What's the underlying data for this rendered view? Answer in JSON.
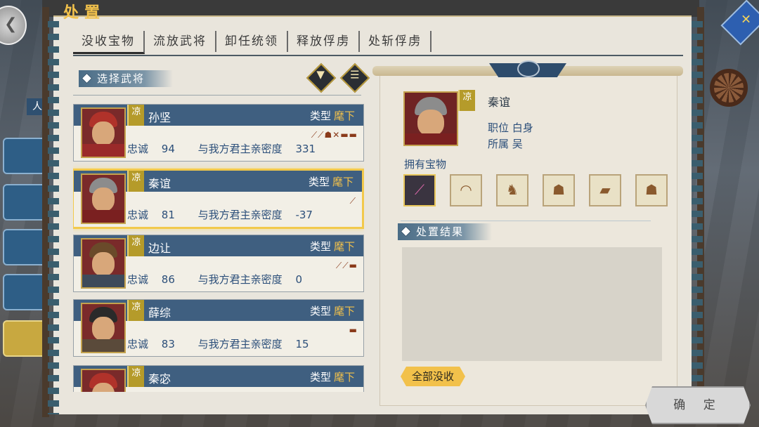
{
  "title": "处置",
  "tabs": [
    {
      "label": "没收宝物"
    },
    {
      "label": "流放武将"
    },
    {
      "label": "卸任统领"
    },
    {
      "label": "释放俘虏"
    },
    {
      "label": "处斩俘虏"
    }
  ],
  "side_label": "人",
  "left": {
    "section_label": "选择武将",
    "filter_icon": "filter-icon",
    "list_icon": "list-icon",
    "type_label": "类型",
    "generals": [
      {
        "faction": "凉",
        "name": "孙坚",
        "type": "麾下",
        "loyalty_label": "忠诚",
        "loyalty": "94",
        "intimacy_label": "与我方君主亲密度",
        "intimacy": "331",
        "items": "⟋⟋☗✕▬▬"
      },
      {
        "faction": "凉",
        "name": "秦谊",
        "type": "麾下",
        "loyalty_label": "忠诚",
        "loyalty": "81",
        "intimacy_label": "与我方君主亲密度",
        "intimacy": "-37",
        "items": "⟋"
      },
      {
        "faction": "凉",
        "name": "边让",
        "type": "麾下",
        "loyalty_label": "忠诚",
        "loyalty": "86",
        "intimacy_label": "与我方君主亲密度",
        "intimacy": "0",
        "items": "⟋⟋▬"
      },
      {
        "faction": "凉",
        "name": "薛综",
        "type": "麾下",
        "loyalty_label": "忠诚",
        "loyalty": "83",
        "intimacy_label": "与我方君主亲密度",
        "intimacy": "15",
        "items": "▬"
      },
      {
        "faction": "凉",
        "name": "秦宓",
        "type": "麾下"
      }
    ]
  },
  "right": {
    "faction": "凉",
    "name": "秦谊",
    "position_label": "职位",
    "position": "白身",
    "affiliation_label": "所属",
    "affiliation": "吴",
    "owned_label": "拥有宝物",
    "treasures": [
      "⟋",
      "◠",
      "♞",
      "☗",
      "▰",
      "☗"
    ],
    "result_label": "处置结果",
    "confiscate_all": "全部没收"
  },
  "confirm": "确 定",
  "colors": {
    "accent": "#f2c14b",
    "header": "#3f5f80",
    "selected_border": "#f2c94c"
  }
}
